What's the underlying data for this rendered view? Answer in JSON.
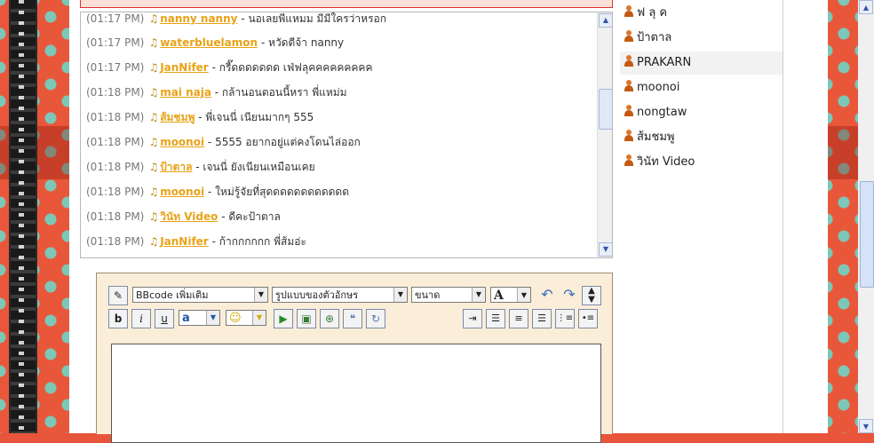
{
  "chat": {
    "messages": [
      {
        "time": "(01:17 PM)",
        "user": "nanny nanny",
        "text": "- นอเลยพี่แหมม มีมีใครว่าหรอก"
      },
      {
        "time": "(01:17 PM)",
        "user": "waterbluelamon",
        "text": "- หวัดดีจ้า nanny"
      },
      {
        "time": "(01:17 PM)",
        "user": "JanNifer",
        "text": "- กรี๊ดดดดดดด เฟ่ฟลุคคคคคคคคค"
      },
      {
        "time": "(01:18 PM)",
        "user": "mai naja",
        "text": "- กล้านอนตอนนี้หรา พี่แหม่ม"
      },
      {
        "time": "(01:18 PM)",
        "user": "ส้มชมพู",
        "text": "- พี่เจนนี่ เนียนมากๆ 555"
      },
      {
        "time": "(01:18 PM)",
        "user": "moonoi",
        "text": "- 5555 อยากอยู่แต่คงโดนไล่ออก"
      },
      {
        "time": "(01:18 PM)",
        "user": "ป้าตาล",
        "text": "- เจนนี่ ยังเนียนเหมือนเคย"
      },
      {
        "time": "(01:18 PM)",
        "user": "moonoi",
        "text": "- ใหม่รู้จัยที่สุดดดดดดดดดดดด"
      },
      {
        "time": "(01:18 PM)",
        "user": "วินัท Video",
        "text": "- ดีคะป้าตาล"
      },
      {
        "time": "(01:18 PM)",
        "user": "JanNifer",
        "text": "- ก้ากกกกกก พี่ส้มอ่ะ"
      }
    ]
  },
  "users": {
    "items": [
      {
        "name": "ฟ ลุ ค"
      },
      {
        "name": "ป้าตาล"
      },
      {
        "name": "PRAKARN"
      },
      {
        "name": "moonoi"
      },
      {
        "name": "nongtaw"
      },
      {
        "name": "ส้มชมพู"
      },
      {
        "name": "วินัท Video"
      }
    ]
  },
  "editor": {
    "bbcode_select": "BBcode เพิ่มเติม",
    "style_select": "รูปแบบของตัวอักษร",
    "size_select": "ขนาด",
    "font_color_label": "A",
    "bold_label": "b",
    "italic_label": "i",
    "underline_label": "u",
    "font_label": "a"
  },
  "colors": {
    "username": "#e8a317",
    "timestamp": "#777777",
    "background": "#e9573b"
  }
}
